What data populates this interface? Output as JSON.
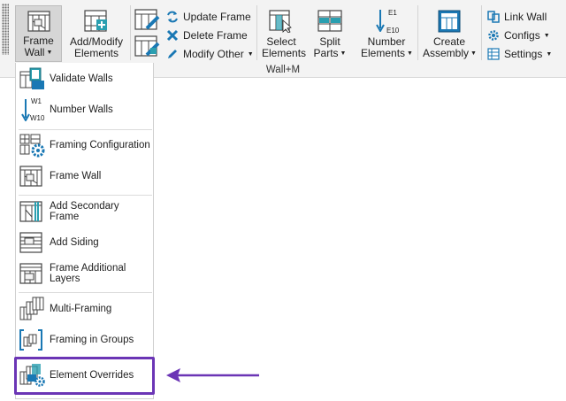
{
  "ribbon": {
    "panel_label": "Wall+M",
    "frame_wall": {
      "line1": "Frame",
      "line2": "Wall"
    },
    "add_modify": {
      "line1": "Add/Modify",
      "line2": "Elements"
    },
    "update_frame": "Update Frame",
    "delete_frame": "Delete Frame",
    "modify_other": "Modify Other",
    "select_elements": {
      "line1": "Select",
      "line2": "Elements"
    },
    "split_parts": {
      "line1": "Split",
      "line2": "Parts"
    },
    "number_elements": {
      "line1": "Number",
      "line2": "Elements",
      "icon_top": "E1",
      "icon_bottom": "E10"
    },
    "create_assembly": {
      "line1": "Create",
      "line2": "Assembly"
    },
    "link_wall": "Link Wall",
    "configs": "Configs",
    "settings": "Settings"
  },
  "menu": {
    "items": [
      {
        "label": "Validate Walls",
        "icon": "validate-walls-icon"
      },
      {
        "label": "Number Walls",
        "icon": "number-walls-icon",
        "icon_top": "W1",
        "icon_bottom": "W10"
      },
      {
        "label": "Framing Configuration",
        "icon": "framing-configuration-icon"
      },
      {
        "label": "Frame Wall",
        "icon": "frame-wall-icon"
      },
      {
        "label": "Add Secondary Frame",
        "icon": "secondary-frame-icon"
      },
      {
        "label": "Add Siding",
        "icon": "siding-icon"
      },
      {
        "label": "Frame Additional Layers",
        "icon": "additional-layers-icon"
      },
      {
        "label": "Multi-Framing",
        "icon": "multi-framing-icon"
      },
      {
        "label": "Framing in Groups",
        "icon": "framing-groups-icon"
      },
      {
        "label": "Element Overrides",
        "icon": "element-overrides-icon"
      }
    ]
  },
  "colors": {
    "highlight": "#6b35b5",
    "icon_blue": "#1a78b4",
    "icon_teal": "#2a9fb0",
    "ribbon_bg": "#f3f3f3"
  }
}
